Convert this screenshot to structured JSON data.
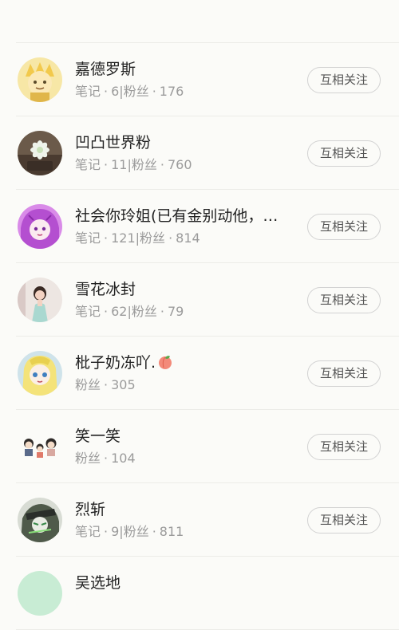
{
  "follow_button_label": "互相关注",
  "labels": {
    "notes": "笔记",
    "fans": "粉丝",
    "dot": "·"
  },
  "users": [
    {
      "name": "",
      "notes": null,
      "fans": null
    },
    {
      "name": "嘉德罗斯",
      "notes": "6",
      "fans": "176"
    },
    {
      "name": "凹凸世界粉",
      "notes": "11",
      "fans": "760"
    },
    {
      "name": "社会你玲姐(已有金别动他，…",
      "notes": "121",
      "fans": "814"
    },
    {
      "name": "雪花冰封",
      "notes": "62",
      "fans": "79"
    },
    {
      "name": "枇子奶冻吖.",
      "notes": null,
      "fans": "305"
    },
    {
      "name": "笑一笑",
      "notes": null,
      "fans": "104"
    },
    {
      "name": "烈斩",
      "notes": "9",
      "fans": "811"
    },
    {
      "name": "吴选地",
      "notes": null,
      "fans": null
    }
  ]
}
